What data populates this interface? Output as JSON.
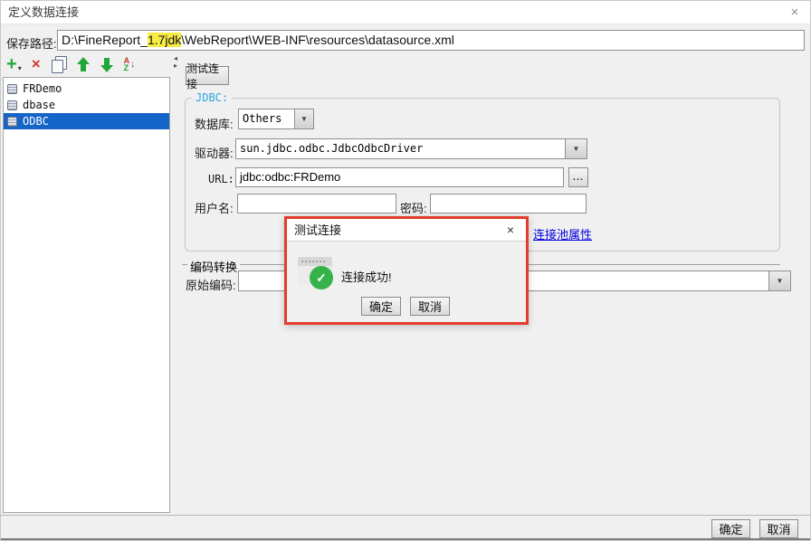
{
  "window": {
    "title": "定义数据连接"
  },
  "icons": {
    "close": "×",
    "dropdown": "▼",
    "caret": "▾",
    "add": "+",
    "delete": "×",
    "sort_a": "A",
    "sort_z": "Z",
    "sort_arrow": "↓",
    "splitter_left": "◂",
    "splitter_right": "▸",
    "ellipsis": "...",
    "check": "✓"
  },
  "path_row": {
    "label": "保存路径:",
    "value_prefix": "D:\\FineReport_",
    "value_highlight": "1.7jdk",
    "value_suffix": "\\WebReport\\WEB-INF\\resources\\datasource.xml",
    "highlight_color": "#f7ec45"
  },
  "connection_list": {
    "selected_index": 2,
    "items": [
      {
        "label": "FRDemo"
      },
      {
        "label": "dbase"
      },
      {
        "label": "ODBC"
      }
    ]
  },
  "right_panel": {
    "test_button": "测试连接",
    "jdbc_group": {
      "title": "JDBC:",
      "database_label": "数据库:",
      "database_value": "Others",
      "driver_label": "驱动器:",
      "driver_value": "sun.jdbc.odbc.JdbcOdbcDriver",
      "url_label": "URL:",
      "url_value": "jdbc:odbc:FRDemo",
      "username_label": "用户名:",
      "username_value": "",
      "password_label": "密码:",
      "password_value": "",
      "pool_link": "连接池属性"
    },
    "encoding_group": {
      "title": "编码转换",
      "original_label": "原始编码:",
      "original_value": ""
    }
  },
  "footer": {
    "ok": "确定",
    "cancel": "取消"
  },
  "dialog": {
    "title": "测试连接",
    "message": "连接成功!",
    "ok": "确定",
    "cancel": "取消",
    "annotation_color": "#e23c2c",
    "success_color": "#35b24a"
  },
  "colors": {
    "selection_blue": "#1565c8",
    "jdbc_title_blue": "#2aa3e2",
    "link_blue": "#0000e0",
    "background": "#f0f0f0"
  }
}
